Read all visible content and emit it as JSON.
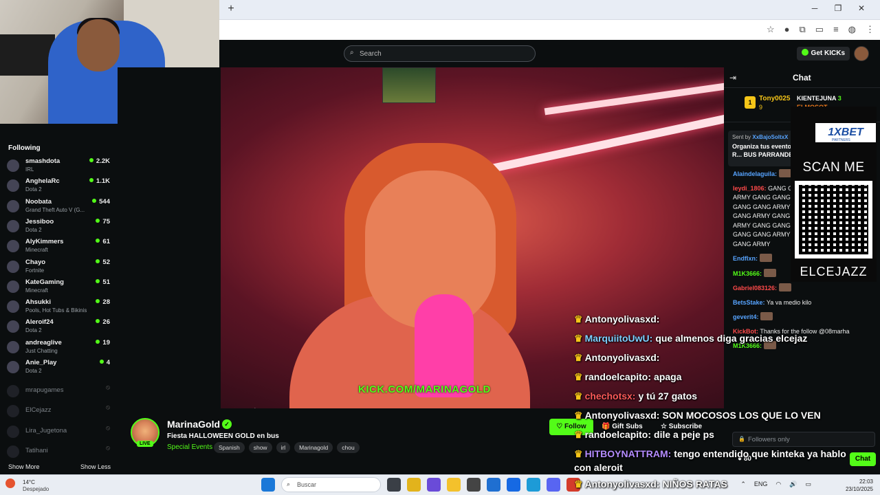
{
  "kick": {
    "search_placeholder": "Search",
    "get_kicks": "Get KICKs"
  },
  "sidebar": {
    "title": "Following",
    "channels": [
      {
        "name": "smashdota",
        "game": "IRL",
        "viewers": "2.2K"
      },
      {
        "name": "AnghelaRc",
        "game": "Dota 2",
        "viewers": "1.1K"
      },
      {
        "name": "Noobata",
        "game": "Grand Theft Auto V (G...",
        "viewers": "544"
      },
      {
        "name": "Jessiboo",
        "game": "Dota 2",
        "viewers": "75"
      },
      {
        "name": "AlyKimmers",
        "game": "Minecraft",
        "viewers": "61"
      },
      {
        "name": "Chayo",
        "game": "Fortnite",
        "viewers": "52"
      },
      {
        "name": "KateGaming",
        "game": "Minecraft",
        "viewers": "51"
      },
      {
        "name": "Ahsukki",
        "game": "Pools, Hot Tubs & Bikinis",
        "viewers": "28"
      },
      {
        "name": "Aleroif24",
        "game": "Dota 2",
        "viewers": "26"
      },
      {
        "name": "andreaglive",
        "game": "Just Chatting",
        "viewers": "19"
      },
      {
        "name": "Anie_Play",
        "game": "Dota 2",
        "viewers": "4"
      }
    ],
    "offline": [
      "mrapugames",
      "ElCejazz",
      "Lira_Jugetona",
      "Tatihani"
    ],
    "show_more": "Show More",
    "show_less": "Show Less"
  },
  "video": {
    "watermark": "KICK.COM/MARINAGOLD"
  },
  "stream": {
    "streamer": "MarinaGold",
    "live": "LIVE",
    "title": "Fiesta HALLOWEEN GOLD en bus",
    "category": "Special Events",
    "tags": [
      "Spanish",
      "show",
      "irl",
      "Marinagold",
      "chou"
    ],
    "follow": "Follow",
    "gift_subs": "Gift Subs",
    "subscribe": "Subscribe"
  },
  "overlay_chat": [
    {
      "user": "Antonyolivasxd:",
      "text": ""
    },
    {
      "user": "MarquiitoUwU:",
      "text": "que almenos diga gracias elcejaz"
    },
    {
      "user": "Antonyolivasxd:",
      "text": ""
    },
    {
      "user": "randoelcapito:",
      "text": "apaga"
    },
    {
      "user": "chechotsx:",
      "text": "y tú 27 gatos"
    },
    {
      "user": "Antonyolivasxd:",
      "text": "SON MOCOSOS LOS QUE LO VEN"
    },
    {
      "user": "randoelcapito:",
      "text": "dile a peje ps"
    },
    {
      "user": "HITBOYNATTRAM:",
      "text": "tengo entendido que kinteka ya hablo con aleroit"
    },
    {
      "user": "Antonyolivasxd:",
      "text": "NIÑOS RATAS"
    }
  ],
  "chat": {
    "title": "Chat",
    "leaderboard": {
      "first_name": "Tony0025",
      "first_count": "9",
      "second_name": "KIENTEJUNA",
      "second_count": "3",
      "third_name": "ELMOSOT"
    },
    "pinned": {
      "sent_by_label": "Sent by",
      "sent_by": "XxBajoSoltxX",
      "text": "Organiza tus eventos con R... BUS PARRANDERO"
    },
    "messages": [
      {
        "user": "Alaindelaguila:",
        "text": "",
        "color": "#57a4ff"
      },
      {
        "user": "leydi_1806:",
        "text": "GANG GANG ARMY GANG GANG ARMY GANG GANG ARMY GANG GANG ARMY GANG GANG ARMY GANG GANG ARMY GANG GANG ARMY GANG GANG ARMY",
        "color": "#ff4a4a"
      },
      {
        "user": "Endflxn:",
        "text": "",
        "color": "#57a4ff"
      },
      {
        "user": "M1K3666:",
        "text": "",
        "color": "#53fc18"
      },
      {
        "user": "Gabriel083126:",
        "text": "",
        "color": "#ff4a4a"
      },
      {
        "user": "BetsStake:",
        "text": "Ya va medio kilo",
        "color": "#57a4ff"
      },
      {
        "user": "geverit4:",
        "text": "",
        "color": "#57a4ff"
      },
      {
        "user": "KickBot:",
        "text": "Thanks for the follow @08marha",
        "color": "#ff4a4a"
      },
      {
        "user": "M1K3666:",
        "text": "",
        "color": "#53fc18"
      }
    ],
    "input_placeholder": "Followers only",
    "kicks": "80",
    "send": "Chat"
  },
  "ad": {
    "brand": "1XBET",
    "partners": "PARTNERS",
    "scan": "SCAN ME",
    "code": "ELCEJAZZ"
  },
  "taskbar": {
    "temp": "14°C",
    "weather": "Despejado",
    "search": "Buscar",
    "lang": "ENG",
    "time": "22:03",
    "date": "23/10/2025"
  }
}
